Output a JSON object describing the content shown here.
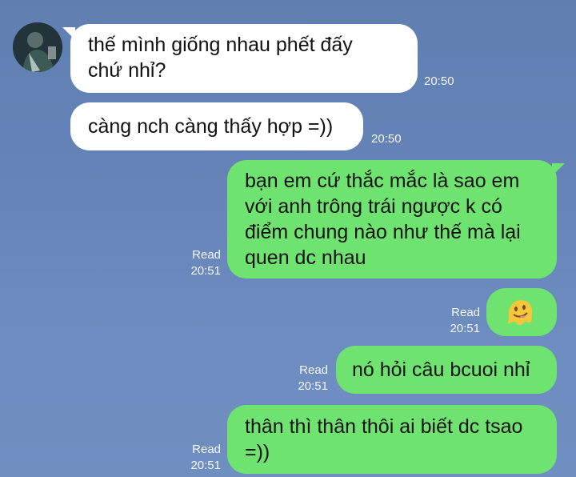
{
  "chat": {
    "avatar_name": "contact-avatar",
    "messages": [
      {
        "id": "m1",
        "side": "received",
        "text_lines": [
          "thế mình giống nhau phết đấy",
          "chứ nhỉ?"
        ],
        "time": "20:50"
      },
      {
        "id": "m2",
        "side": "received",
        "text_lines": [
          "càng nch càng thấy hợp =))"
        ],
        "time": "20:50"
      },
      {
        "id": "m3",
        "side": "sent",
        "text_lines": [
          "bạn em cứ thắc mắc là sao em",
          "với anh trông trái ngược k có",
          "điểm chung nào như thế mà lại",
          "quen dc nhau"
        ],
        "read": "Read",
        "time": "20:51"
      },
      {
        "id": "m4",
        "side": "sent",
        "emoji": "melting-face",
        "read": "Read",
        "time": "20:51"
      },
      {
        "id": "m5",
        "side": "sent",
        "text_lines": [
          "nó hỏi câu bcuoi nhỉ"
        ],
        "read": "Read",
        "time": "20:51"
      },
      {
        "id": "m6",
        "side": "sent",
        "text_lines": [
          "thân thì thân thôi ai biết dc tsao",
          "=))"
        ],
        "read": "Read",
        "time": "20:51"
      }
    ]
  },
  "colors": {
    "background": "#6585b8",
    "received_bubble": "#ffffff",
    "sent_bubble": "#6fe36f",
    "meta_text": "#f4f7fb"
  }
}
